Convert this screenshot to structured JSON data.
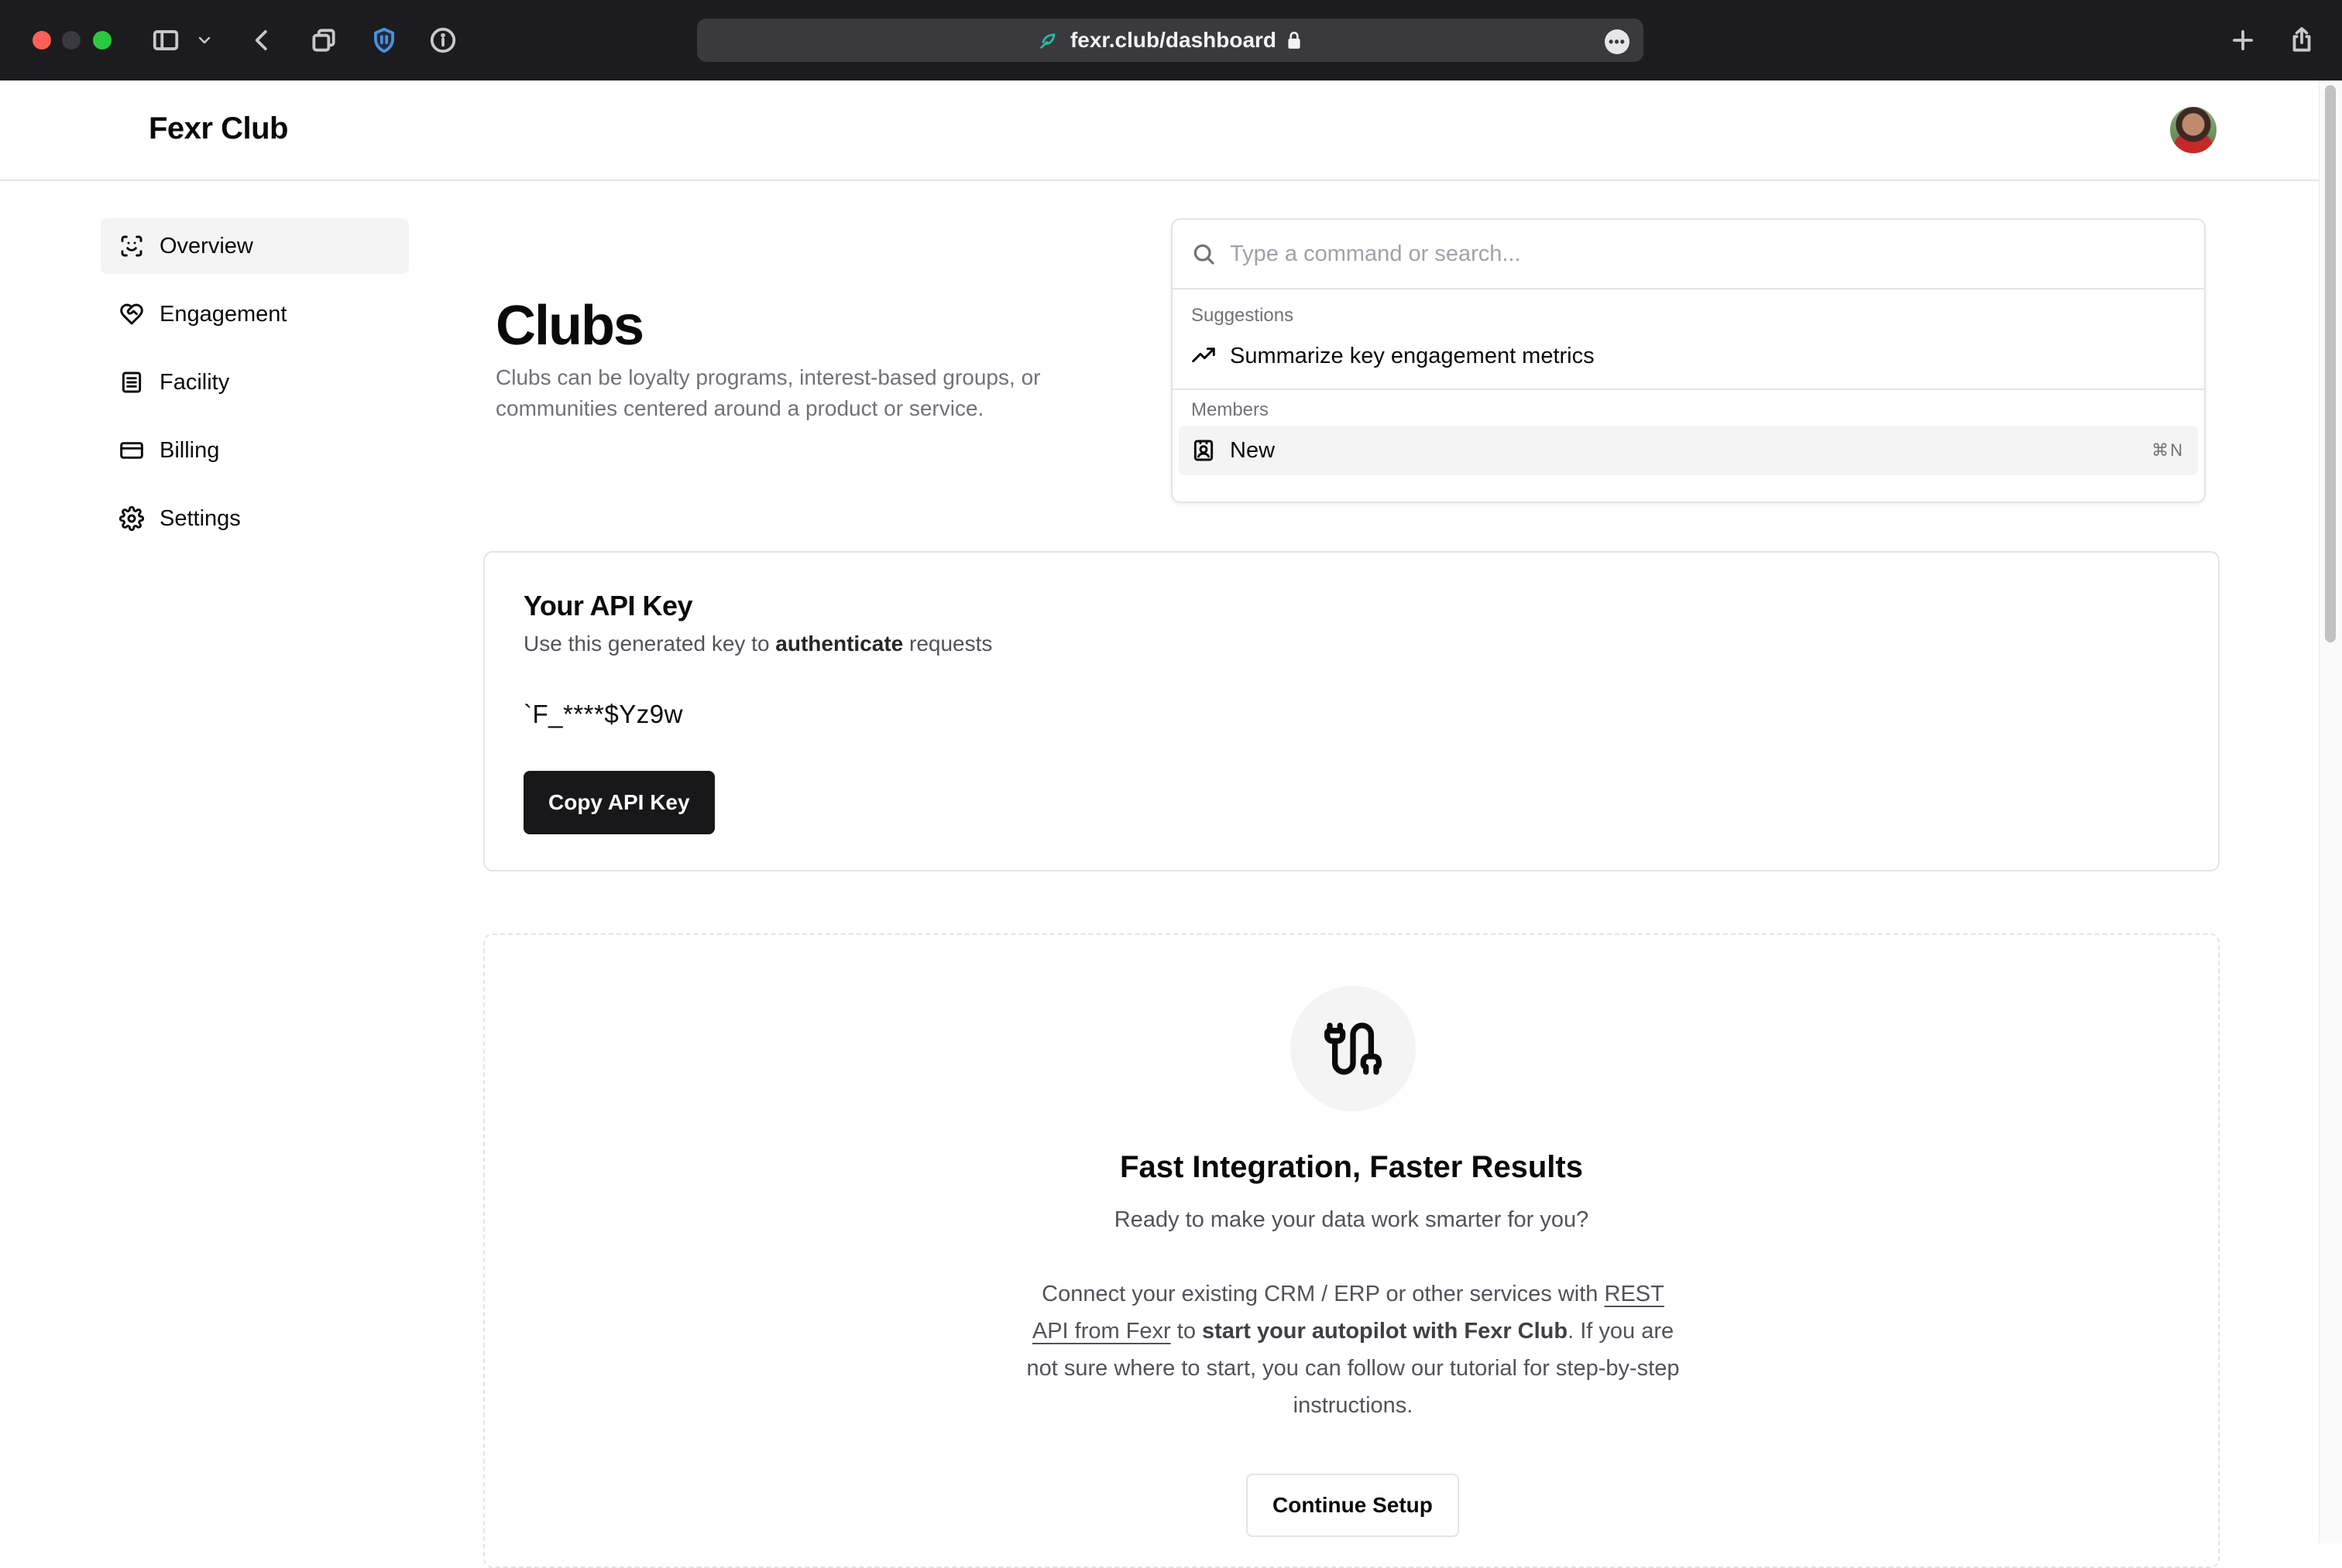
{
  "browser": {
    "url": "fexr.club/dashboard",
    "more_glyph": "•••"
  },
  "header": {
    "brand": "Fexr Club"
  },
  "sidebar": {
    "items": [
      {
        "label": "Overview",
        "icon": "scan-face-icon"
      },
      {
        "label": "Engagement",
        "icon": "heart-handshake-icon"
      },
      {
        "label": "Facility",
        "icon": "building-icon"
      },
      {
        "label": "Billing",
        "icon": "credit-card-icon"
      },
      {
        "label": "Settings",
        "icon": "gear-icon"
      }
    ]
  },
  "page": {
    "title": "Clubs",
    "description": "Clubs can be loyalty programs, interest-based groups, or communities centered around a product or service."
  },
  "command": {
    "placeholder": "Type a command or search...",
    "groups": [
      {
        "label": "Suggestions",
        "items": [
          {
            "label": "Summarize key engagement metrics",
            "icon": "trending-up-icon"
          }
        ]
      },
      {
        "label": "Members",
        "items": [
          {
            "label": "New",
            "icon": "contact-icon",
            "shortcut": "⌘N"
          }
        ]
      }
    ]
  },
  "api": {
    "title": "Your API Key",
    "subtitle_pre": "Use this generated key to ",
    "subtitle_bold": "authenticate",
    "subtitle_post": " requests",
    "key": "`F_****$Yz9w",
    "copy_label": "Copy API Key"
  },
  "integration": {
    "title": "Fast Integration, Faster Results",
    "subtitle": "Ready to make your data work smarter for you?",
    "body_pre": "Connect your existing CRM / ERP or other services with ",
    "body_link": "REST API from Fexr",
    "body_mid": " to ",
    "body_bold": "start your autopilot with Fexr Club",
    "body_post": ". If you are not sure where to start, you can follow our tutorial for step-by-step instructions.",
    "button_label": "Continue Setup"
  },
  "colors": {
    "primary_button": "#18181b",
    "muted_text": "#71717a",
    "border": "#e4e4e7",
    "active_bg": "#f4f4f5"
  }
}
